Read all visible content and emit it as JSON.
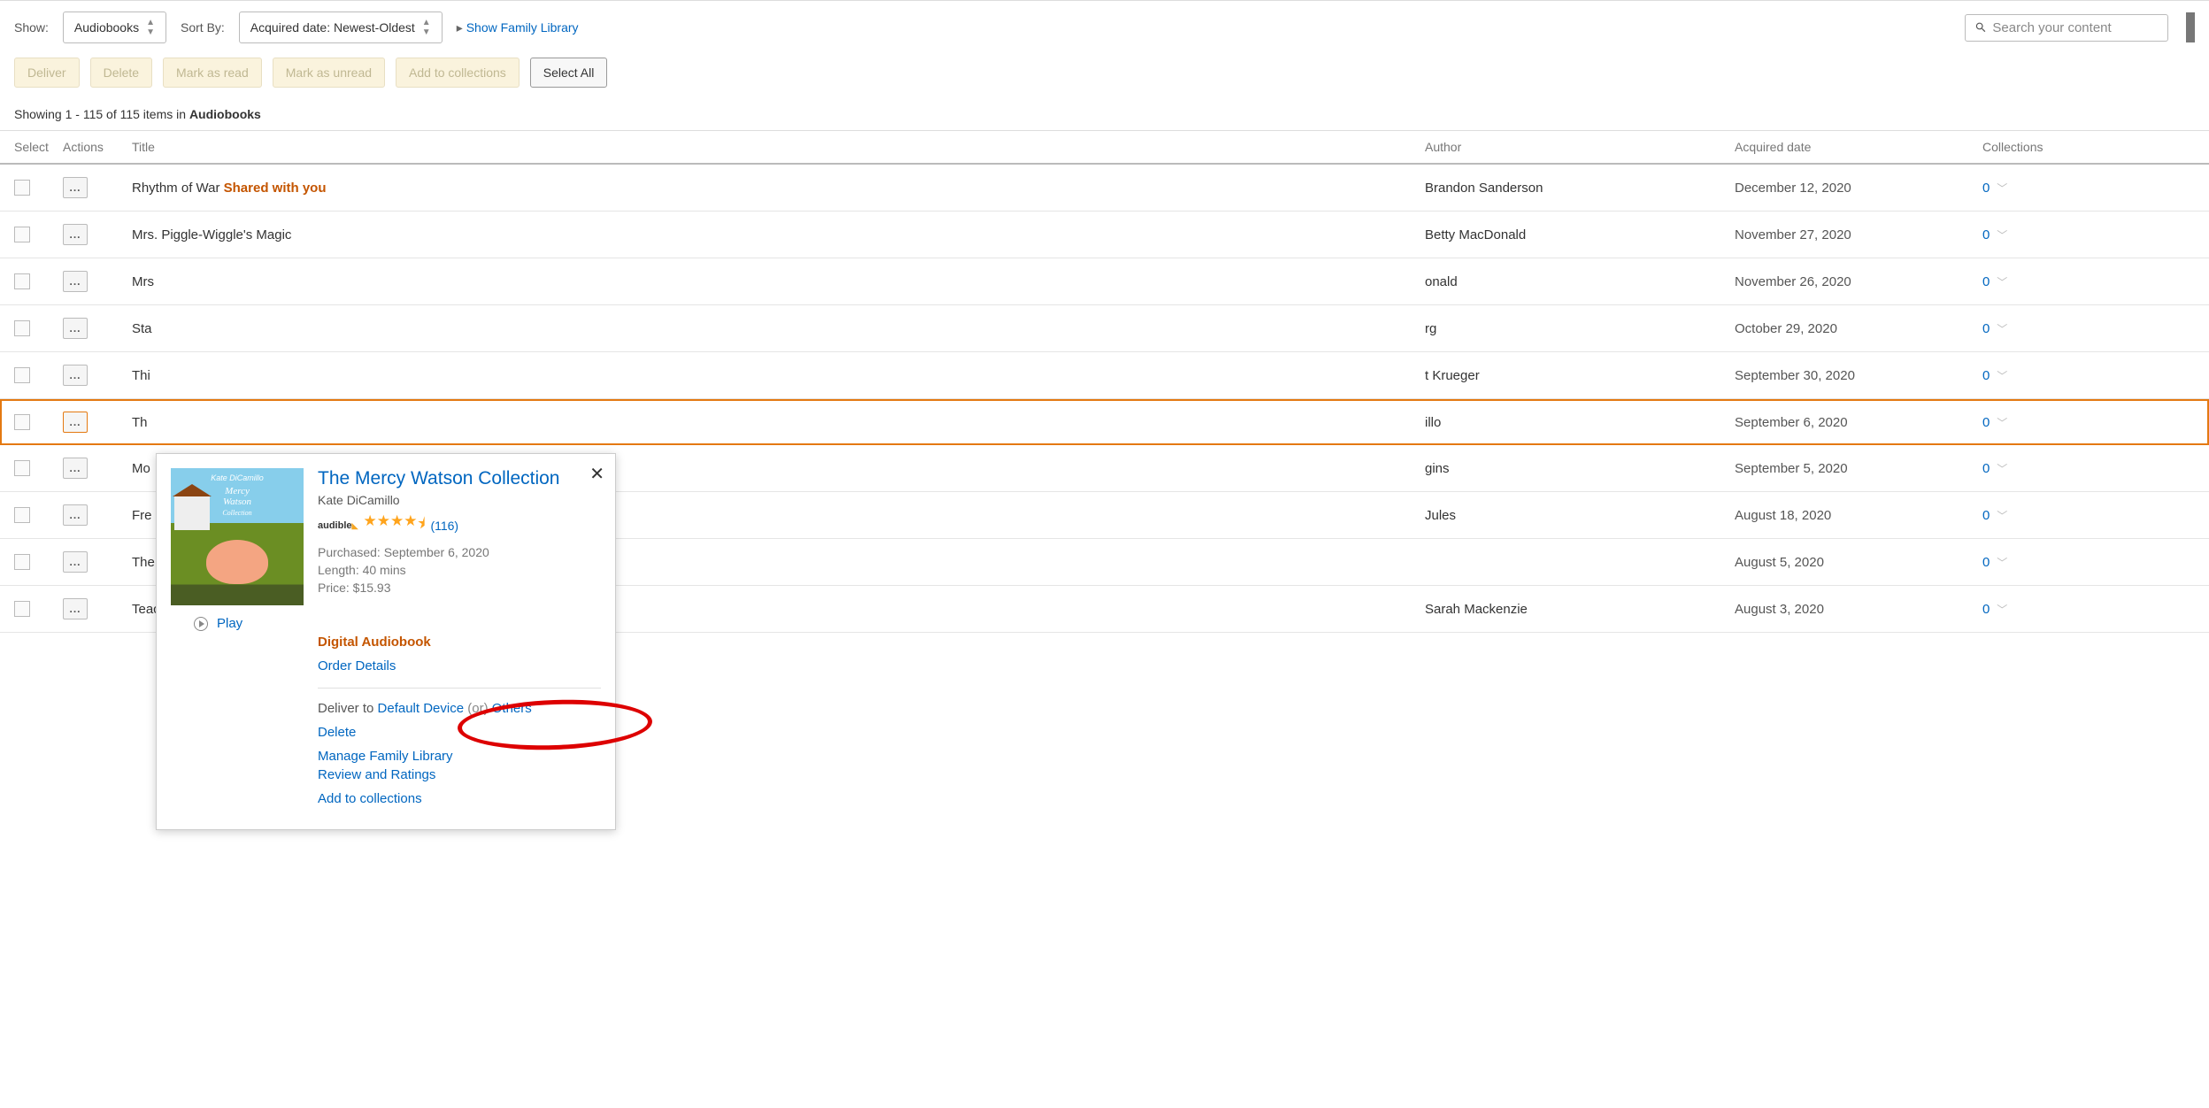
{
  "toolbar": {
    "show_label": "Show:",
    "show_value": "Audiobooks",
    "sort_label": "Sort By:",
    "sort_value": "Acquired date: Newest-Oldest",
    "family_link": "Show Family Library",
    "search_placeholder": "Search your content"
  },
  "actions": {
    "deliver": "Deliver",
    "delete": "Delete",
    "mark_read": "Mark as read",
    "mark_unread": "Mark as unread",
    "add_collections": "Add to collections",
    "select_all": "Select All"
  },
  "status": {
    "prefix": "Showing 1 - 115 of 115 items in ",
    "category": "Audiobooks"
  },
  "headers": {
    "select": "Select",
    "actions": "Actions",
    "title": "Title",
    "author": "Author",
    "date": "Acquired date",
    "collections": "Collections"
  },
  "rows": [
    {
      "title": "Rhythm of War ",
      "shared": "Shared with you",
      "author": "Brandon Sanderson",
      "date": "December 12, 2020",
      "coll": "0"
    },
    {
      "title": "Mrs. Piggle-Wiggle's Magic",
      "shared": "",
      "author": "Betty MacDonald",
      "date": "November 27, 2020",
      "coll": "0"
    },
    {
      "title": "Mrs",
      "shared": "",
      "author": "onald",
      "date": "November 26, 2020",
      "coll": "0"
    },
    {
      "title": "Sta",
      "shared": "",
      "author": "rg",
      "date": "October 29, 2020",
      "coll": "0"
    },
    {
      "title": "Thi",
      "shared": "",
      "author": "t Krueger",
      "date": "September 30, 2020",
      "coll": "0"
    },
    {
      "title": "Th",
      "shared": "",
      "author": "illo",
      "date": "September 6, 2020",
      "coll": "0"
    },
    {
      "title": "Mo",
      "shared": "",
      "author": "gins",
      "date": "September 5, 2020",
      "coll": "0"
    },
    {
      "title": "Fre",
      "shared": "",
      "author": "Jules",
      "date": "August 18, 2020",
      "coll": "0"
    },
    {
      "title": "The",
      "shared": "",
      "author": "",
      "date": "August 5, 2020",
      "coll": "0"
    },
    {
      "title": "Teaching from Rest",
      "shared": "",
      "author": "Sarah Mackenzie",
      "date": "August 3, 2020",
      "coll": "0"
    }
  ],
  "popup": {
    "title": "The Mercy Watson Collection",
    "author": "Kate DiCamillo",
    "audible": "audible",
    "rating_count": "(116)",
    "purchased": "Purchased: September 6, 2020",
    "length": "Length:  40 mins",
    "price": "Price:  $15.93",
    "play": "Play",
    "digital": "Digital Audiobook",
    "order_details": "Order Details",
    "deliver_label": "Deliver to  ",
    "default_device": "Default Device",
    "or": "(or)",
    "others": "Others",
    "delete": "Delete",
    "manage_family": "Manage Family Library",
    "review": "Review and Ratings",
    "add_coll": "Add to collections",
    "cover_author": "Kate DiCamillo",
    "cover_title": "Mercy Watson"
  }
}
